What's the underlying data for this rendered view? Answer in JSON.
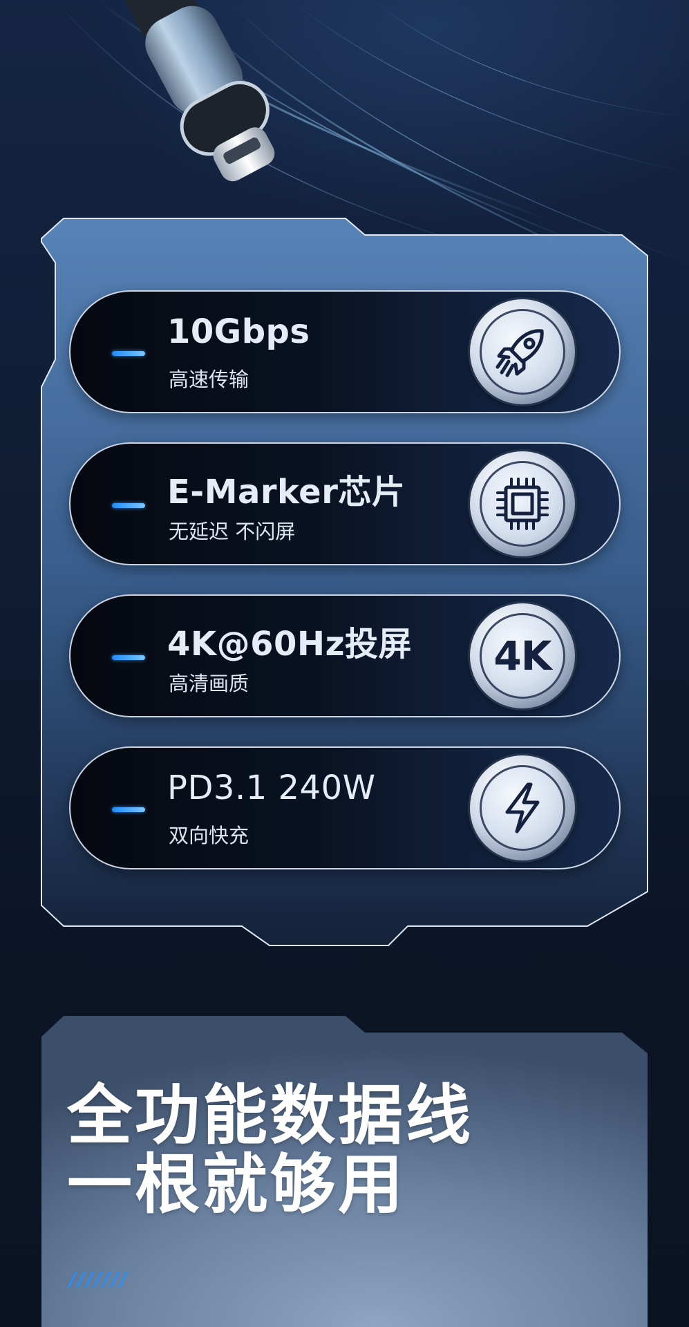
{
  "features": [
    {
      "title": "10Gbps",
      "subtitle": "高速传输",
      "icon": "rocket-icon"
    },
    {
      "title": "E-Marker芯片",
      "subtitle": "无延迟 不闪屏",
      "icon": "chip-icon"
    },
    {
      "title": "4K@60Hz投屏",
      "subtitle": "高清画质",
      "icon_text": "4K"
    },
    {
      "title": "PD3.1 240W",
      "subtitle": "双向快充",
      "icon": "lightning-icon"
    }
  ],
  "headline": {
    "line1": "全功能数据线",
    "line2": "一根就够用"
  },
  "decoration": {
    "slashes": "///////"
  },
  "colors": {
    "accent_blue": "#2c8df2",
    "panel_blue": "#5a85b8",
    "background": "#0d1628"
  }
}
